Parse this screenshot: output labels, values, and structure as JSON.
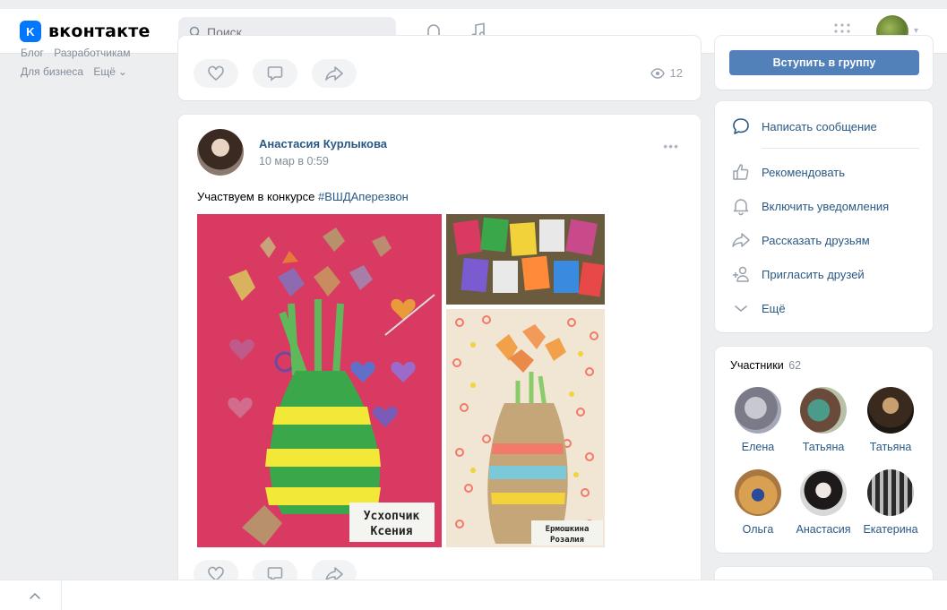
{
  "header": {
    "logo_mark": "K",
    "logo_text": "вконтакте",
    "search_placeholder": "Поиск"
  },
  "leftnav": {
    "links_row1": [
      "Блог",
      "Разработчикам"
    ],
    "links_row2": [
      "Для бизнеса",
      "Ещё"
    ]
  },
  "prev_post": {
    "views": "12"
  },
  "post": {
    "author": "Анастасия Курлыкова",
    "date": "10 мар в 0:59",
    "text": "Участвуем в конкурсе ",
    "hashtag": "#ВШДАперезвон",
    "img_a_caption": "Усхопчик Ксения",
    "img_c_caption": "Ермошкина Розалия"
  },
  "group_menu": {
    "join_label": "Вступить в группу",
    "items": [
      {
        "label": "Написать сообщение",
        "icon": "message-icon"
      },
      {
        "label": "Рекомендовать",
        "icon": "thumbs-up-icon"
      },
      {
        "label": "Включить уведомления",
        "icon": "bell-icon"
      },
      {
        "label": "Рассказать друзьям",
        "icon": "share-icon"
      },
      {
        "label": "Пригласить друзей",
        "icon": "add-user-icon"
      },
      {
        "label": "Ещё",
        "icon": "chevron-down-icon"
      }
    ]
  },
  "members": {
    "title": "Участники",
    "count": "62",
    "list": [
      {
        "name": "Елена"
      },
      {
        "name": "Татьяна"
      },
      {
        "name": "Татьяна"
      },
      {
        "name": "Ольга"
      },
      {
        "name": "Анастасия"
      },
      {
        "name": "Екатерина"
      }
    ]
  },
  "colors": {
    "accent": "#0077ff",
    "link": "#2a5885",
    "button": "#5181b8",
    "page_bg": "#edeef0"
  }
}
